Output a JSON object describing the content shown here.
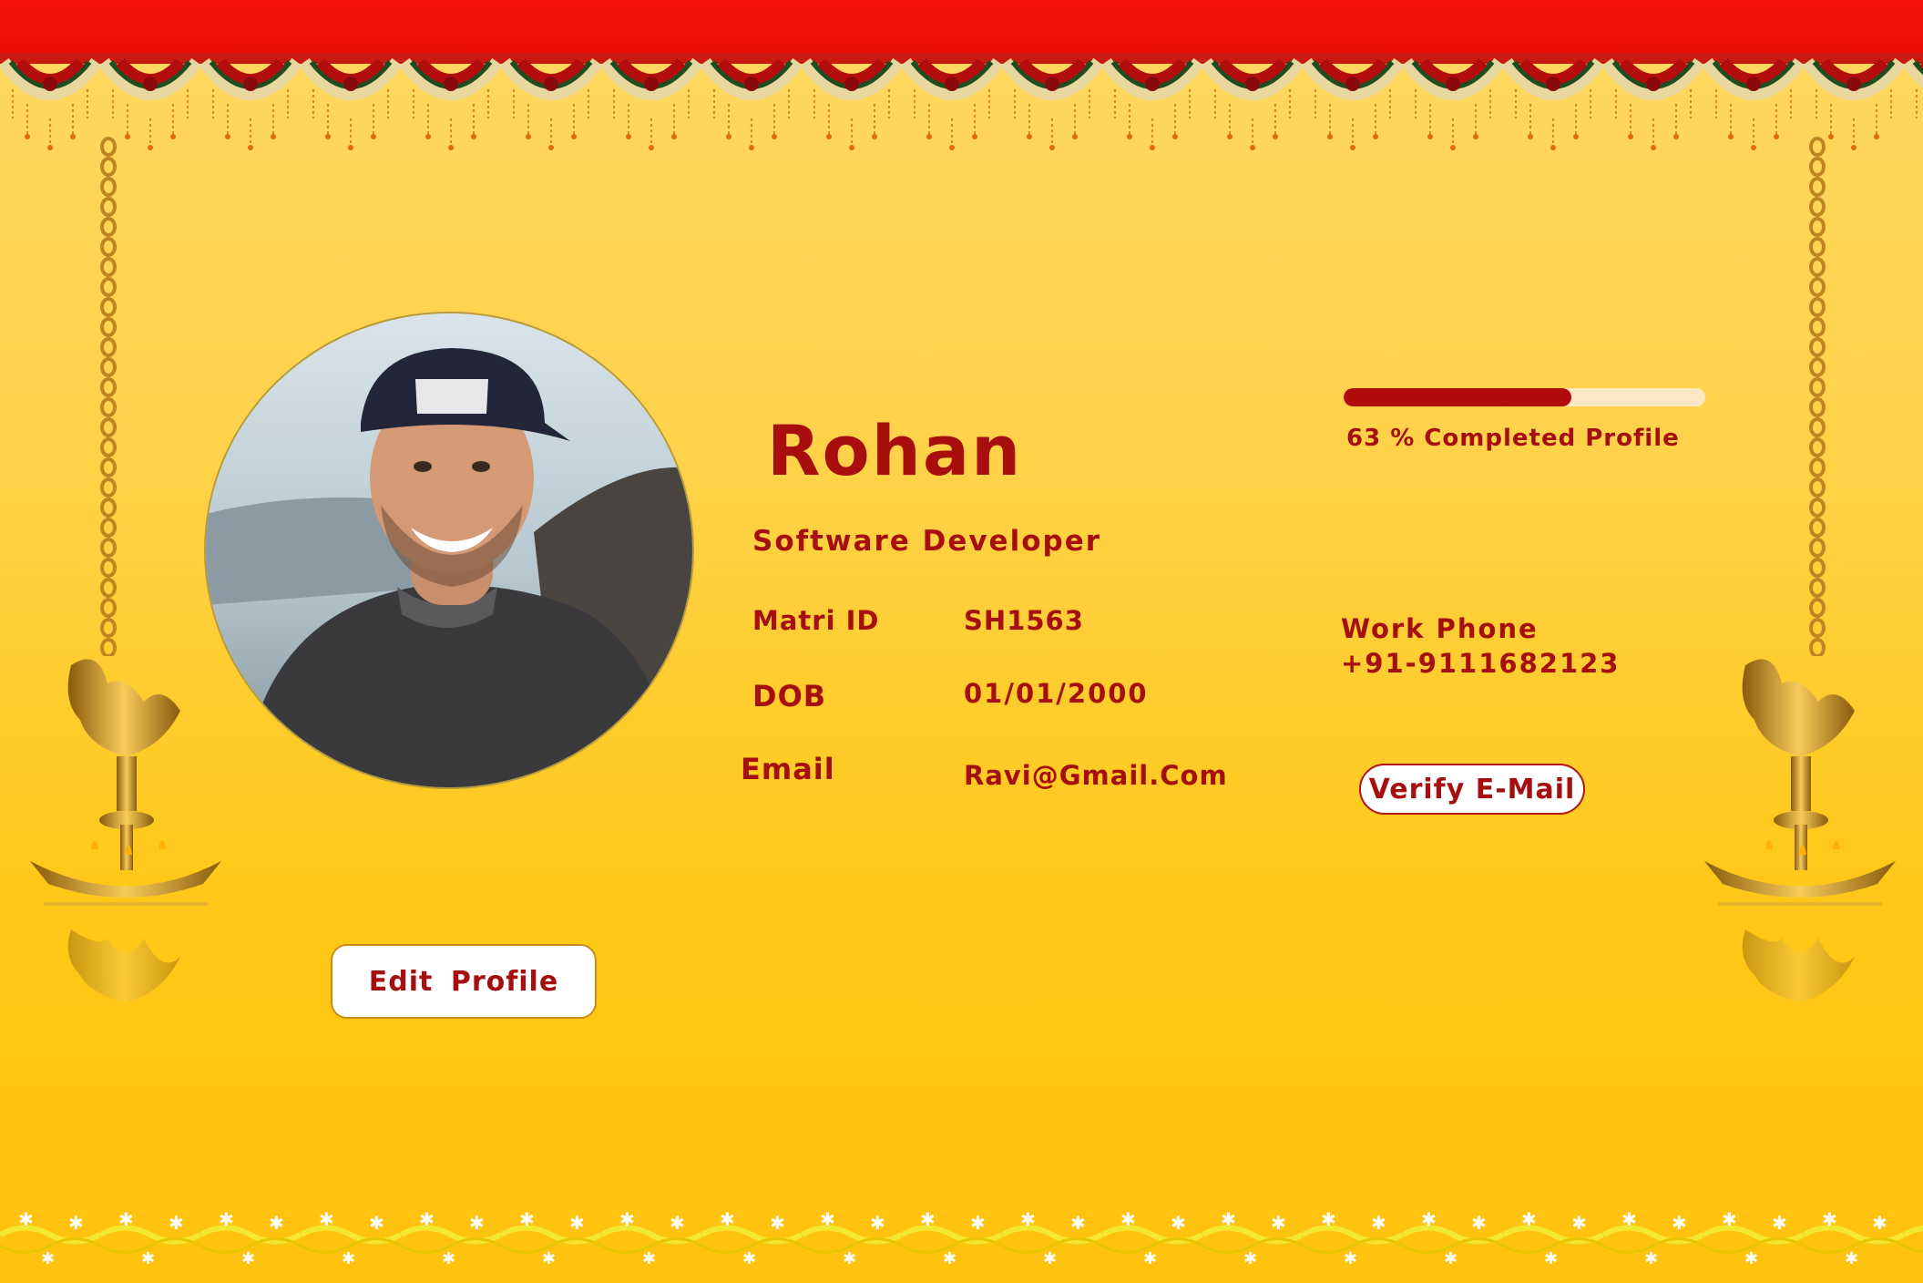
{
  "header": {
    "accent_color": "#e90d04"
  },
  "profile": {
    "name": "Rohan",
    "occupation": "Software Developer",
    "avatar": "profile-photo",
    "fields": {
      "matri_id_label": "Matri ID",
      "matri_id_value": "SH1563",
      "dob_label": "DOB",
      "dob_value": "01/01/2000",
      "email_label": "Email",
      "email_value": "Ravi@Gmail.Com"
    }
  },
  "progress": {
    "percent": 63,
    "label": "63 % Completed Profile"
  },
  "contact": {
    "work_phone_label": "Work Phone",
    "work_phone_value": "+91-9111682123"
  },
  "actions": {
    "verify_email_label": "Verify E-Mail",
    "edit_profile_label": "Edit  Profile"
  },
  "colors": {
    "text": "#a50f0f",
    "background": "#ffc817",
    "progress_fill": "#b00c0c",
    "progress_track": "#fbe7c4"
  }
}
